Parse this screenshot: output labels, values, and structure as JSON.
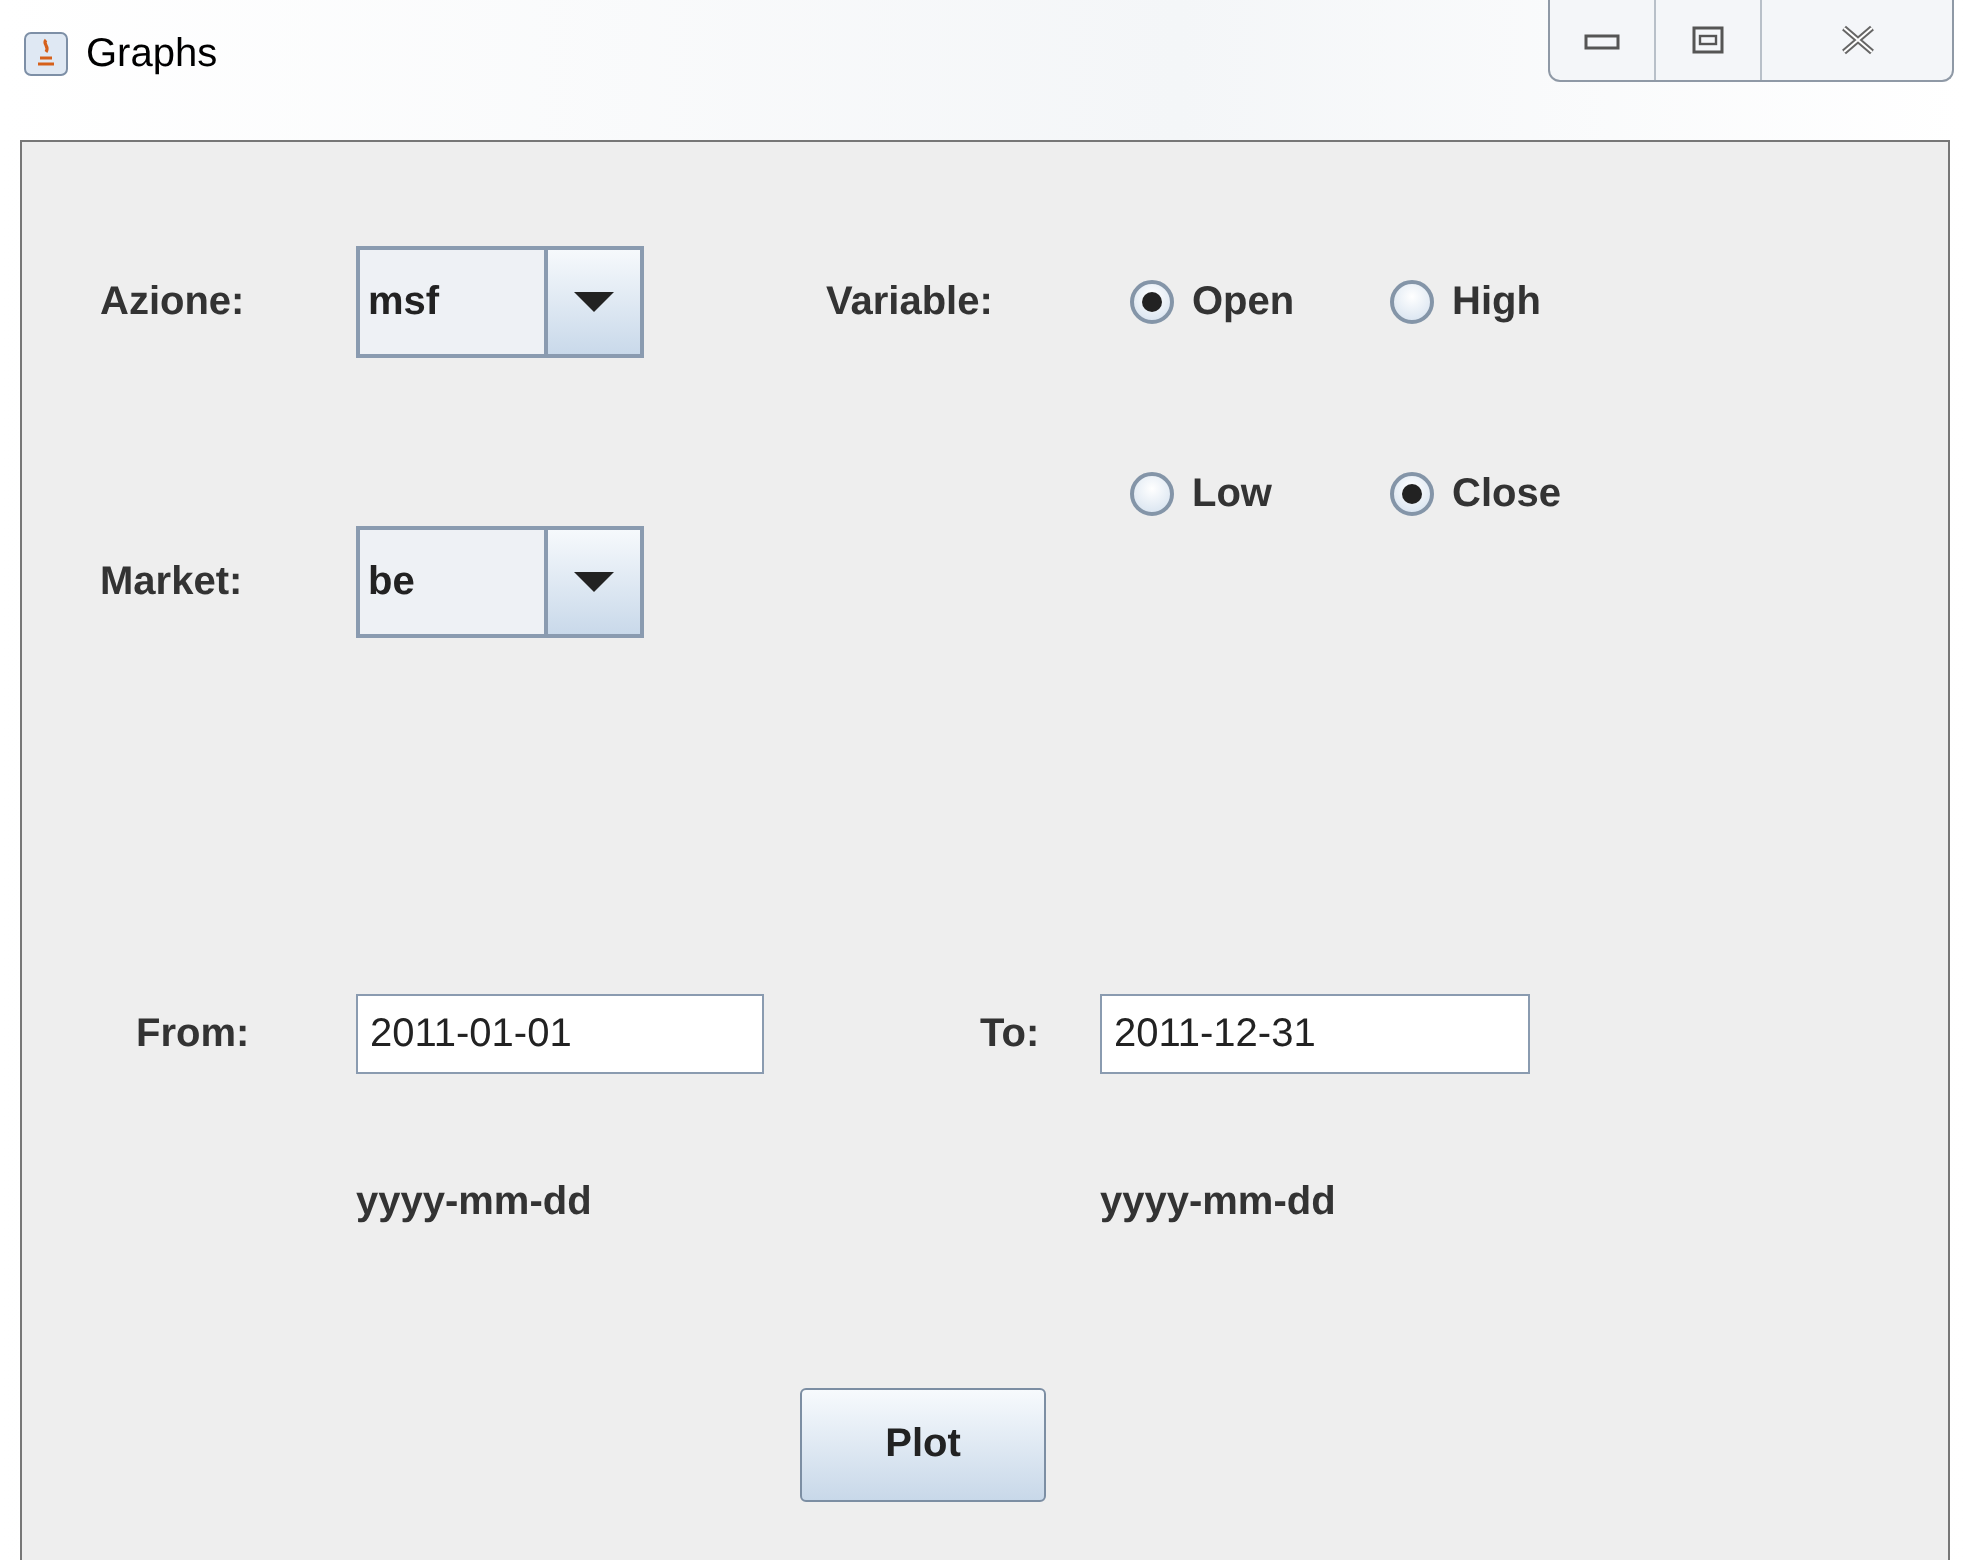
{
  "window": {
    "title": "Graphs"
  },
  "azione": {
    "label": "Azione:",
    "value": "msf"
  },
  "market": {
    "label": "Market:",
    "value": "be"
  },
  "variable": {
    "label": "Variable:",
    "options": [
      {
        "label": "Open",
        "selected": true
      },
      {
        "label": "High",
        "selected": false
      },
      {
        "label": "Low",
        "selected": false
      },
      {
        "label": "Close",
        "selected": true
      }
    ]
  },
  "from": {
    "label": "From:",
    "value": "2011-01-01",
    "hint": "yyyy-mm-dd"
  },
  "to": {
    "label": "To:",
    "value": "2011-12-31",
    "hint": "yyyy-mm-dd"
  },
  "buttons": [
    "Plot"
  ]
}
